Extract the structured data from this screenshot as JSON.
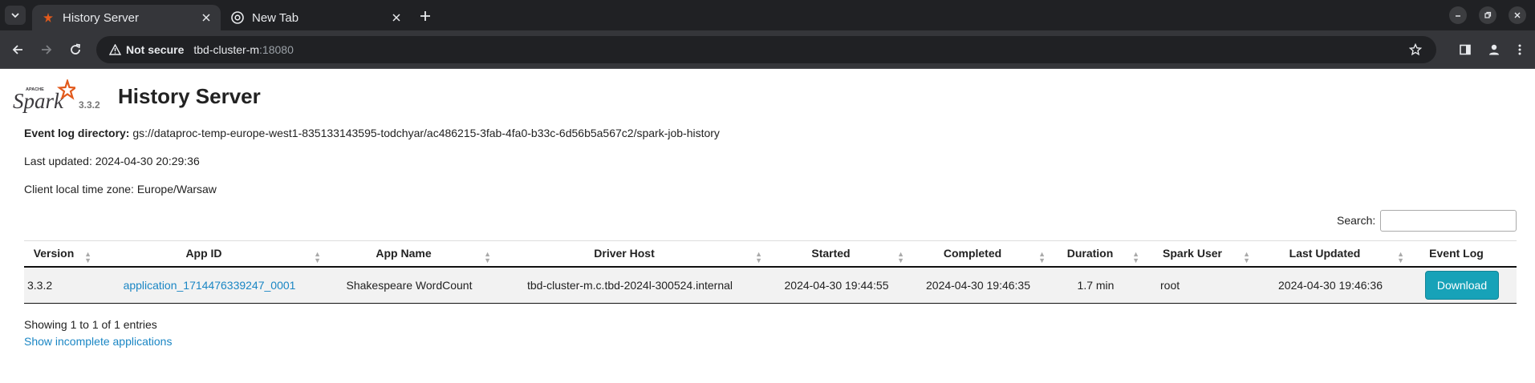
{
  "browser": {
    "tabs": [
      {
        "title": "History Server",
        "active": true,
        "favicon": "spark-icon"
      },
      {
        "title": "New Tab",
        "active": false,
        "favicon": "chrome-icon"
      }
    ],
    "security_label": "Not secure",
    "url_host": "tbd-cluster-m",
    "url_port": ":18080"
  },
  "header": {
    "title": "History Server",
    "spark_version": "3.3.2"
  },
  "info": {
    "event_log_label": "Event log directory:",
    "event_log_value": "gs://dataproc-temp-europe-west1-835133143595-todchyar/ac486215-3fab-4fa0-b33c-6d56b5a567c2/spark-job-history",
    "last_updated": "Last updated: 2024-04-30 20:29:36",
    "timezone": "Client local time zone: Europe/Warsaw"
  },
  "search": {
    "label": "Search:",
    "value": ""
  },
  "table": {
    "headers": [
      "Version",
      "App ID",
      "App Name",
      "Driver Host",
      "Started",
      "Completed",
      "Duration",
      "Spark User",
      "Last Updated",
      "Event Log"
    ],
    "rows": [
      {
        "version": "3.3.2",
        "app_id": "application_1714476339247_0001",
        "app_name": "Shakespeare WordCount",
        "driver_host": "tbd-cluster-m.c.tbd-2024l-300524.internal",
        "started": "2024-04-30 19:44:55",
        "completed": "2024-04-30 19:46:35",
        "duration": "1.7 min",
        "spark_user": "root",
        "last_updated": "2024-04-30 19:46:36",
        "event_log": "Download"
      }
    ]
  },
  "footer": {
    "showing": "Showing 1 to 1 of 1 entries",
    "incomplete_link": "Show incomplete applications"
  },
  "colors": {
    "link": "#1a86c4",
    "download_button": "#17a2b8",
    "tab_strip": "#202124",
    "toolbar": "#35363a"
  }
}
